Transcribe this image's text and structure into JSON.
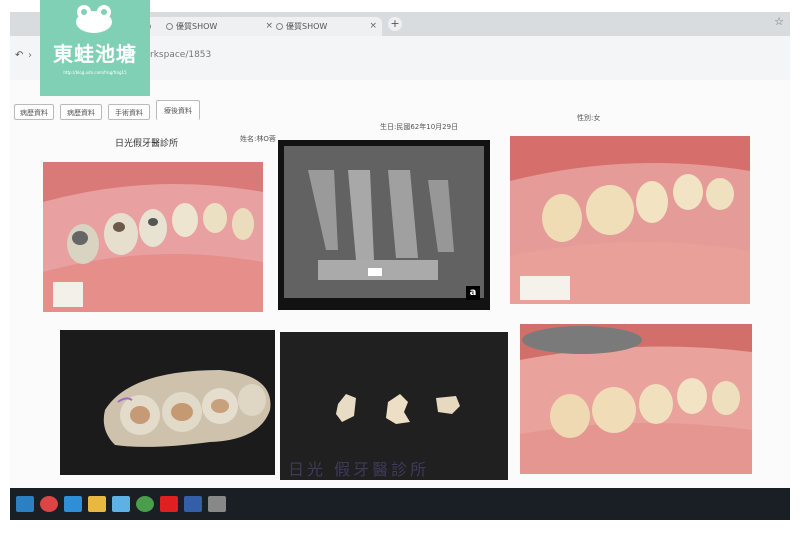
{
  "browser": {
    "tabs": [
      {
        "title": ""
      },
      {
        "title": "優質SHOW"
      },
      {
        "title": "優質SHOW"
      }
    ],
    "close_glyph": "×",
    "new_tab_glyph": "+",
    "bookmark_glyph": "☆",
    "url": "rkspace/1853",
    "back_glyph": "↶",
    "forward_glyph": "›"
  },
  "page": {
    "tabs": [
      {
        "label": "病歷資料"
      },
      {
        "label": "病歷資料"
      },
      {
        "label": "手術資料"
      },
      {
        "label": "療後資料"
      }
    ],
    "clinic_name": "日光假牙醫診所",
    "patient": {
      "name": "姓名:林O蓉",
      "birth": "生日:民國62年10月29日",
      "gender": "性別:女"
    },
    "xray_label": "a"
  },
  "watermark": "日光 假牙醫診所",
  "logo": {
    "title": "東蛙池塘",
    "url": "http://blog.udn.com/frog/frog15"
  },
  "taskbar": {
    "icons": [
      "chrome-icon",
      "ie-icon",
      "folder-icon",
      "explorer-icon",
      "chrome-alt-icon",
      "red-app-icon",
      "media-icon",
      "photo-icon"
    ],
    "tray_time": "",
    "tray_date": ""
  },
  "colors": {
    "accent": "#7fd0b5",
    "taskbar": "#1a1f25",
    "gum": "#d9736f"
  }
}
